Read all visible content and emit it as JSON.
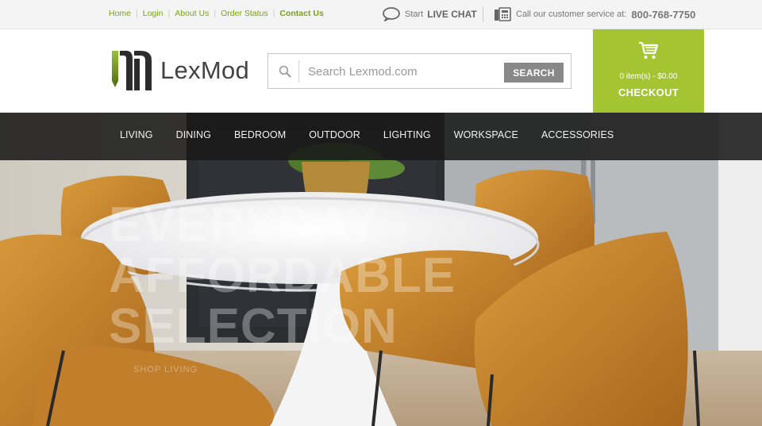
{
  "utility_bar": {
    "links": [
      "Home",
      "Login",
      "About Us",
      "Order Status",
      "Contact Us"
    ],
    "chat_prefix": "Start",
    "chat_label": "LIVE CHAT",
    "phone_label": "Call our customer service at:",
    "phone_number": "800-768-7750"
  },
  "logo": {
    "text": "LexMod"
  },
  "search": {
    "placeholder": "Search Lexmod.com",
    "value": "",
    "button_label": "SEARCH"
  },
  "checkout": {
    "summary": "0 item(s) - $0.00",
    "label": "CHECKOUT"
  },
  "nav": {
    "items": [
      "LIVING",
      "DINING",
      "BEDROOM",
      "OUTDOOR",
      "LIGHTING",
      "WORKSPACE",
      "ACCESSORIES"
    ]
  },
  "hero": {
    "headline_line1": "EVERYDAY AFFORDABLE",
    "headline_line2": "SELECTION",
    "cta": "SHOP LIVING"
  },
  "colors": {
    "accent": "#a4c531",
    "link": "#7aa30f",
    "nav_bg": "#1e1e1e"
  },
  "icons": [
    "chat-bubble-icon",
    "phone-icon",
    "search-icon",
    "cart-icon",
    "logo-mark-icon"
  ]
}
